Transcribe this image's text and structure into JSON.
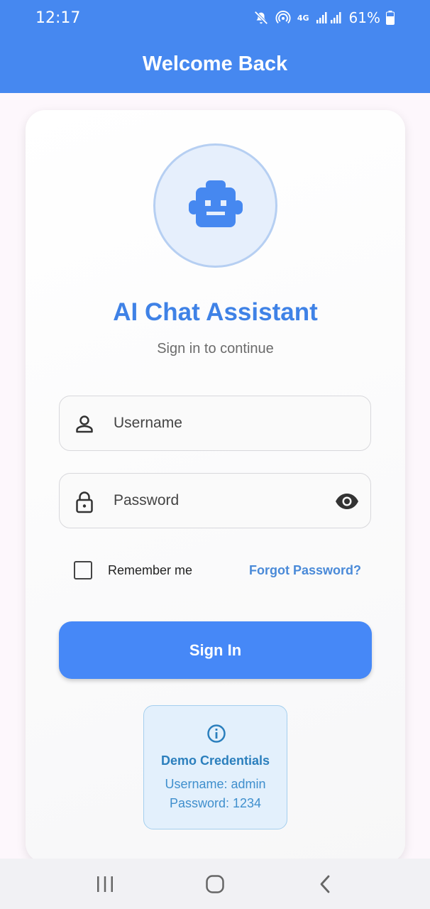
{
  "status_bar": {
    "time": "12:17",
    "network": "4G",
    "battery": "61%"
  },
  "app_bar": {
    "title": "Welcome Back"
  },
  "card": {
    "avatar_icon": "robot-icon",
    "title": "AI Chat Assistant",
    "subtitle": "Sign in to continue",
    "username": {
      "placeholder": "Username",
      "value": "",
      "icon": "person-icon"
    },
    "password": {
      "placeholder": "Password",
      "value": "",
      "icon": "lock-icon",
      "toggle_icon": "eye-icon"
    },
    "remember_label": "Remember me",
    "remember_checked": false,
    "forgot_label": "Forgot Password?",
    "signin_label": "Sign In",
    "demo": {
      "icon": "info-icon",
      "title": "Demo Credentials",
      "username_line": "Username: admin",
      "password_line": "Password: 1234"
    }
  },
  "colors": {
    "primary": "#4688f0",
    "title": "#3f82e6",
    "link": "#4a8ad8",
    "demo_bg": "#e3f0fc",
    "demo_text": "#2b7fbd"
  },
  "nav_bar": {
    "recents_icon": "recents-icon",
    "home_icon": "home-icon",
    "back_icon": "back-icon"
  }
}
